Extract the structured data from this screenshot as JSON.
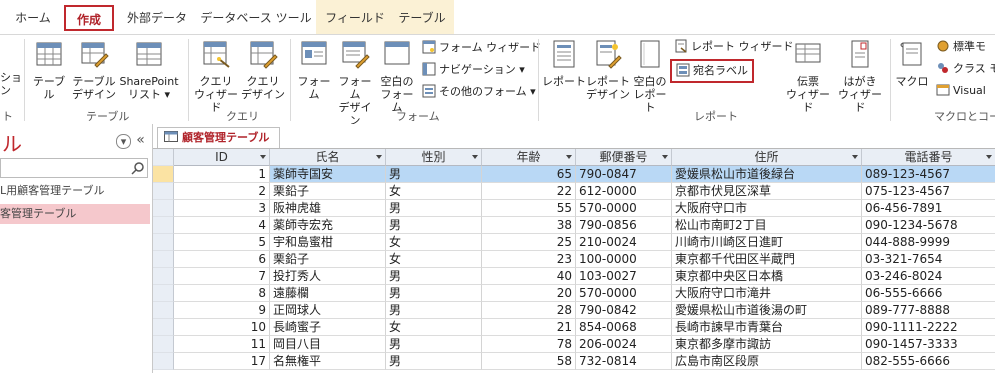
{
  "ribbon_tabs": [
    {
      "label": "ホーム",
      "active": false
    },
    {
      "label": "作成",
      "active": true
    },
    {
      "label": "外部データ",
      "active": false
    },
    {
      "label": "データベース ツール",
      "active": false
    },
    {
      "label": "フィールド",
      "active": false
    },
    {
      "label": "テーブル",
      "active": false
    }
  ],
  "ribbon": {
    "groups": {
      "left_cut": "ト",
      "tables": "テーブル",
      "query": "クエリ",
      "forms": "フォーム",
      "reports": "レポート",
      "macros": "マクロとコード"
    },
    "buttons": {
      "left_cut": "ション",
      "table": "テーブル",
      "table_design_1": "テーブル",
      "table_design_2": "デザイン",
      "sharepoint_1": "SharePoint",
      "sharepoint_2": "リスト ▾",
      "query_wizard_1": "クエリ",
      "query_wizard_2": "ウィザード",
      "query_design_1": "クエリ",
      "query_design_2": "デザイン",
      "form": "フォーム",
      "form_design_1": "フォーム",
      "form_design_2": "デザイン",
      "blank_form_1": "空白の",
      "blank_form_2": "フォーム",
      "form_wizard": "フォーム ウィザード",
      "navigation": "ナビゲーション ▾",
      "other_forms": "その他のフォーム ▾",
      "report": "レポート",
      "report_design_1": "レポート",
      "report_design_2": "デザイン",
      "blank_report_1": "空白の",
      "blank_report_2": "レポート",
      "report_wizard": "レポート ウィザード",
      "label": "宛名ラベル",
      "slip_wizard_1": "伝票",
      "slip_wizard_2": "ウィザード",
      "postcard_wizard_1": "はがき",
      "postcard_wizard_2": "ウィザード",
      "macro": "マクロ",
      "standard_module": "標準モ",
      "class_module": "クラス モ",
      "visual_basic": "Visual"
    }
  },
  "nav_pane": {
    "title": "ル",
    "items": [
      "L用顧客管理テーブル",
      "客管理テーブル"
    ],
    "selected_index": 1
  },
  "document": {
    "tab_label": "顧客管理テーブル",
    "columns": [
      "ID",
      "氏名",
      "性別",
      "年齢",
      "郵便番号",
      "住所",
      "電話番号"
    ],
    "active_row": 0,
    "rows": [
      [
        "1",
        "薬師寺国安",
        "男",
        "65",
        "790-0847",
        "愛媛県松山市道後緑台",
        "089-123-4567"
      ],
      [
        "2",
        "栗鉛子",
        "女",
        "22",
        "612-0000",
        "京都市伏見区深草",
        "075-123-4567"
      ],
      [
        "3",
        "阪神虎雄",
        "男",
        "55",
        "570-0000",
        "大阪府守口市",
        "06-456-7891"
      ],
      [
        "4",
        "薬師寺宏充",
        "男",
        "38",
        "790-0856",
        "松山市南町2丁目",
        "090-1234-5678"
      ],
      [
        "5",
        "宇和島蜜柑",
        "女",
        "25",
        "210-0024",
        "川崎市川崎区日進町",
        "044-888-9999"
      ],
      [
        "6",
        "栗鉛子",
        "女",
        "23",
        "100-0000",
        "東京都千代田区半蔵門",
        "03-321-7654"
      ],
      [
        "7",
        "投打秀人",
        "男",
        "40",
        "103-0027",
        "東京都中央区日本橋",
        "03-246-8024"
      ],
      [
        "8",
        "遠藤欄",
        "男",
        "20",
        "570-0000",
        "大阪府守口市滝井",
        "06-555-6666"
      ],
      [
        "9",
        "正岡球人",
        "男",
        "28",
        "790-0842",
        "愛媛県松山市道後湯の町",
        "089-777-8888"
      ],
      [
        "10",
        "長崎蜜子",
        "女",
        "21",
        "854-0068",
        "長崎市諫早市青葉台",
        "090-1111-2222"
      ],
      [
        "11",
        "岡目八目",
        "男",
        "78",
        "206-0024",
        "東京都多摩市諏訪",
        "090-1457-3333"
      ],
      [
        "17",
        "名無権平",
        "男",
        "58",
        "732-0814",
        "広島市南区段原",
        "082-555-6666"
      ]
    ]
  },
  "colors": {
    "accent": "#c0282d",
    "selected_row": "#b9d8f5",
    "nav_selected": "#f5c8cc",
    "header_bg": "#e9eef5"
  }
}
